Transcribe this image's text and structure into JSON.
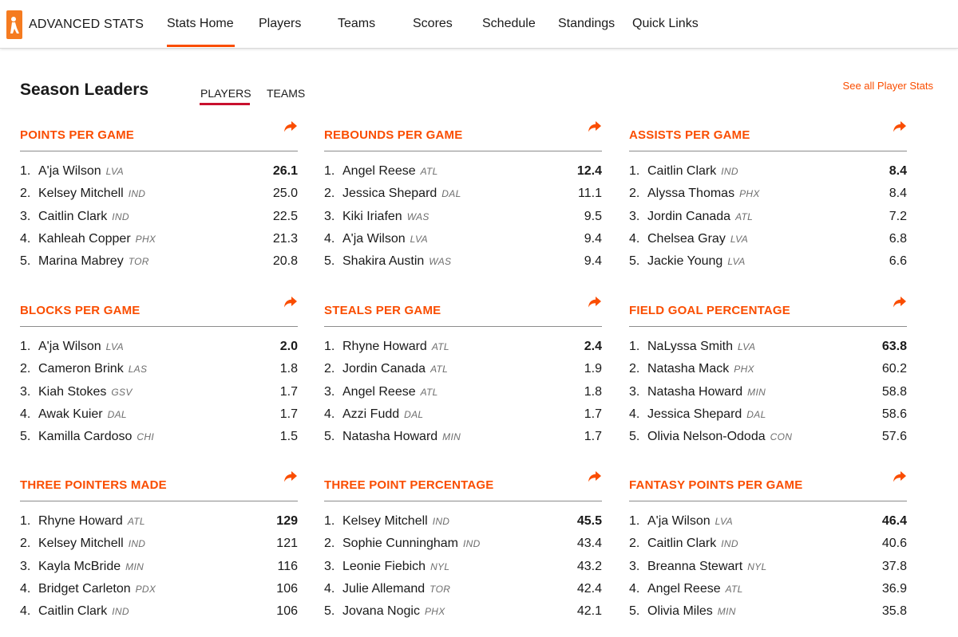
{
  "brand": "ADVANCED STATS",
  "nav": [
    "Stats Home",
    "Players",
    "Teams",
    "Scores",
    "Schedule",
    "Standings",
    "Quick Links"
  ],
  "heading": "Season Leaders",
  "subtabs": [
    "PLAYERS",
    "TEAMS"
  ],
  "see_all": "See all Player Stats",
  "colors": {
    "accent": "#fa4d00",
    "logo": "#f57b20",
    "subtab_underline": "#c8102e"
  },
  "cards": [
    {
      "title": "POINTS PER GAME",
      "rows": [
        {
          "rank": "1.",
          "name": "A'ja Wilson",
          "team": "LVA",
          "value": "26.1"
        },
        {
          "rank": "2.",
          "name": "Kelsey Mitchell",
          "team": "IND",
          "value": "25.0"
        },
        {
          "rank": "3.",
          "name": "Caitlin Clark",
          "team": "IND",
          "value": "22.5"
        },
        {
          "rank": "4.",
          "name": "Kahleah Copper",
          "team": "PHX",
          "value": "21.3"
        },
        {
          "rank": "5.",
          "name": "Marina Mabrey",
          "team": "TOR",
          "value": "20.8"
        }
      ]
    },
    {
      "title": "REBOUNDS PER GAME",
      "rows": [
        {
          "rank": "1.",
          "name": "Angel Reese",
          "team": "ATL",
          "value": "12.4"
        },
        {
          "rank": "2.",
          "name": "Jessica Shepard",
          "team": "DAL",
          "value": "11.1"
        },
        {
          "rank": "3.",
          "name": "Kiki Iriafen",
          "team": "WAS",
          "value": "9.5"
        },
        {
          "rank": "4.",
          "name": "A'ja Wilson",
          "team": "LVA",
          "value": "9.4"
        },
        {
          "rank": "5.",
          "name": "Shakira Austin",
          "team": "WAS",
          "value": "9.4"
        }
      ]
    },
    {
      "title": "ASSISTS PER GAME",
      "rows": [
        {
          "rank": "1.",
          "name": "Caitlin Clark",
          "team": "IND",
          "value": "8.4"
        },
        {
          "rank": "2.",
          "name": "Alyssa Thomas",
          "team": "PHX",
          "value": "8.4"
        },
        {
          "rank": "3.",
          "name": "Jordin Canada",
          "team": "ATL",
          "value": "7.2"
        },
        {
          "rank": "4.",
          "name": "Chelsea Gray",
          "team": "LVA",
          "value": "6.8"
        },
        {
          "rank": "5.",
          "name": "Jackie Young",
          "team": "LVA",
          "value": "6.6"
        }
      ]
    },
    {
      "title": "BLOCKS PER GAME",
      "rows": [
        {
          "rank": "1.",
          "name": "A'ja Wilson",
          "team": "LVA",
          "value": "2.0"
        },
        {
          "rank": "2.",
          "name": "Cameron Brink",
          "team": "LAS",
          "value": "1.8"
        },
        {
          "rank": "3.",
          "name": "Kiah Stokes",
          "team": "GSV",
          "value": "1.7"
        },
        {
          "rank": "4.",
          "name": "Awak Kuier",
          "team": "DAL",
          "value": "1.7"
        },
        {
          "rank": "5.",
          "name": "Kamilla Cardoso",
          "team": "CHI",
          "value": "1.5"
        }
      ]
    },
    {
      "title": "STEALS PER GAME",
      "rows": [
        {
          "rank": "1.",
          "name": "Rhyne Howard",
          "team": "ATL",
          "value": "2.4"
        },
        {
          "rank": "2.",
          "name": "Jordin Canada",
          "team": "ATL",
          "value": "1.9"
        },
        {
          "rank": "3.",
          "name": "Angel Reese",
          "team": "ATL",
          "value": "1.8"
        },
        {
          "rank": "4.",
          "name": "Azzi Fudd",
          "team": "DAL",
          "value": "1.7"
        },
        {
          "rank": "5.",
          "name": "Natasha Howard",
          "team": "MIN",
          "value": "1.7"
        }
      ]
    },
    {
      "title": "FIELD GOAL PERCENTAGE",
      "rows": [
        {
          "rank": "1.",
          "name": "NaLyssa Smith",
          "team": "LVA",
          "value": "63.8"
        },
        {
          "rank": "2.",
          "name": "Natasha Mack",
          "team": "PHX",
          "value": "60.2"
        },
        {
          "rank": "3.",
          "name": "Natasha Howard",
          "team": "MIN",
          "value": "58.8"
        },
        {
          "rank": "4.",
          "name": "Jessica Shepard",
          "team": "DAL",
          "value": "58.6"
        },
        {
          "rank": "5.",
          "name": "Olivia Nelson-Ododa",
          "team": "CON",
          "value": "57.6"
        }
      ]
    },
    {
      "title": "THREE POINTERS MADE",
      "rows": [
        {
          "rank": "1.",
          "name": "Rhyne Howard",
          "team": "ATL",
          "value": "129"
        },
        {
          "rank": "2.",
          "name": "Kelsey Mitchell",
          "team": "IND",
          "value": "121"
        },
        {
          "rank": "3.",
          "name": "Kayla McBride",
          "team": "MIN",
          "value": "116"
        },
        {
          "rank": "4.",
          "name": "Bridget Carleton",
          "team": "PDX",
          "value": "106"
        },
        {
          "rank": "4.",
          "name": "Caitlin Clark",
          "team": "IND",
          "value": "106"
        }
      ]
    },
    {
      "title": "THREE POINT PERCENTAGE",
      "rows": [
        {
          "rank": "1.",
          "name": "Kelsey Mitchell",
          "team": "IND",
          "value": "45.5"
        },
        {
          "rank": "2.",
          "name": "Sophie Cunningham",
          "team": "IND",
          "value": "43.4"
        },
        {
          "rank": "3.",
          "name": "Leonie Fiebich",
          "team": "NYL",
          "value": "43.2"
        },
        {
          "rank": "4.",
          "name": "Julie Allemand",
          "team": "TOR",
          "value": "42.4"
        },
        {
          "rank": "5.",
          "name": "Jovana Nogic",
          "team": "PHX",
          "value": "42.1"
        }
      ]
    },
    {
      "title": "FANTASY POINTS PER GAME",
      "rows": [
        {
          "rank": "1.",
          "name": "A'ja Wilson",
          "team": "LVA",
          "value": "46.4"
        },
        {
          "rank": "2.",
          "name": "Caitlin Clark",
          "team": "IND",
          "value": "40.6"
        },
        {
          "rank": "3.",
          "name": "Breanna Stewart",
          "team": "NYL",
          "value": "37.8"
        },
        {
          "rank": "4.",
          "name": "Angel Reese",
          "team": "ATL",
          "value": "36.9"
        },
        {
          "rank": "5.",
          "name": "Olivia Miles",
          "team": "MIN",
          "value": "35.8"
        }
      ]
    }
  ]
}
